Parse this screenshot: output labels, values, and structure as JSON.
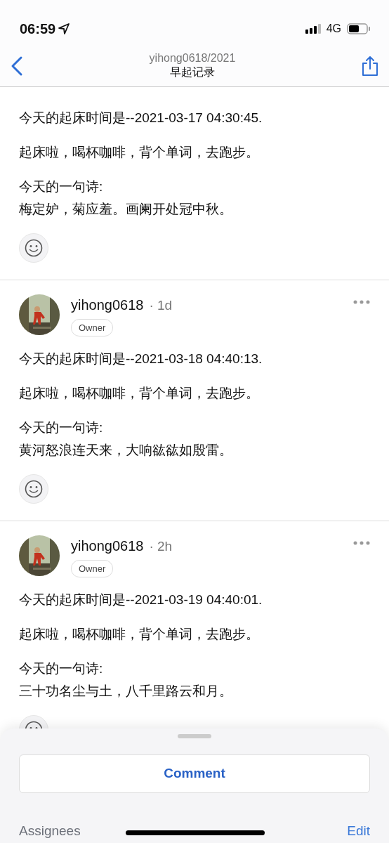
{
  "status_bar": {
    "time": "06:59",
    "network": "4G"
  },
  "nav": {
    "subtitle": "yihong0618/2021",
    "title": "早起记录"
  },
  "comments": [
    {
      "lines": [
        "今天的起床时间是--2021-03-17 04:30:45.",
        "起床啦，喝杯咖啡，背个单词，去跑步。"
      ],
      "poem_label": "今天的一句诗:",
      "poem": "梅定妒，菊应羞。画阑开处冠中秋。"
    },
    {
      "author": "yihong0618",
      "age": "· 1d",
      "role": "Owner",
      "lines": [
        "今天的起床时间是--2021-03-18 04:40:13.",
        "起床啦，喝杯咖啡，背个单词，去跑步。"
      ],
      "poem_label": "今天的一句诗:",
      "poem": "黄河怒浪连天来，大响谹谹如殷雷。"
    },
    {
      "author": "yihong0618",
      "age": "· 2h",
      "role": "Owner",
      "lines": [
        "今天的起床时间是--2021-03-19 04:40:01.",
        "起床啦，喝杯咖啡，背个单词，去跑步。"
      ],
      "poem_label": "今天的一句诗:",
      "poem": "三十功名尘与土，八千里路云和月。"
    }
  ],
  "sheet": {
    "comment_button": "Comment",
    "section_label": "Assignees",
    "edit_link": "Edit"
  }
}
